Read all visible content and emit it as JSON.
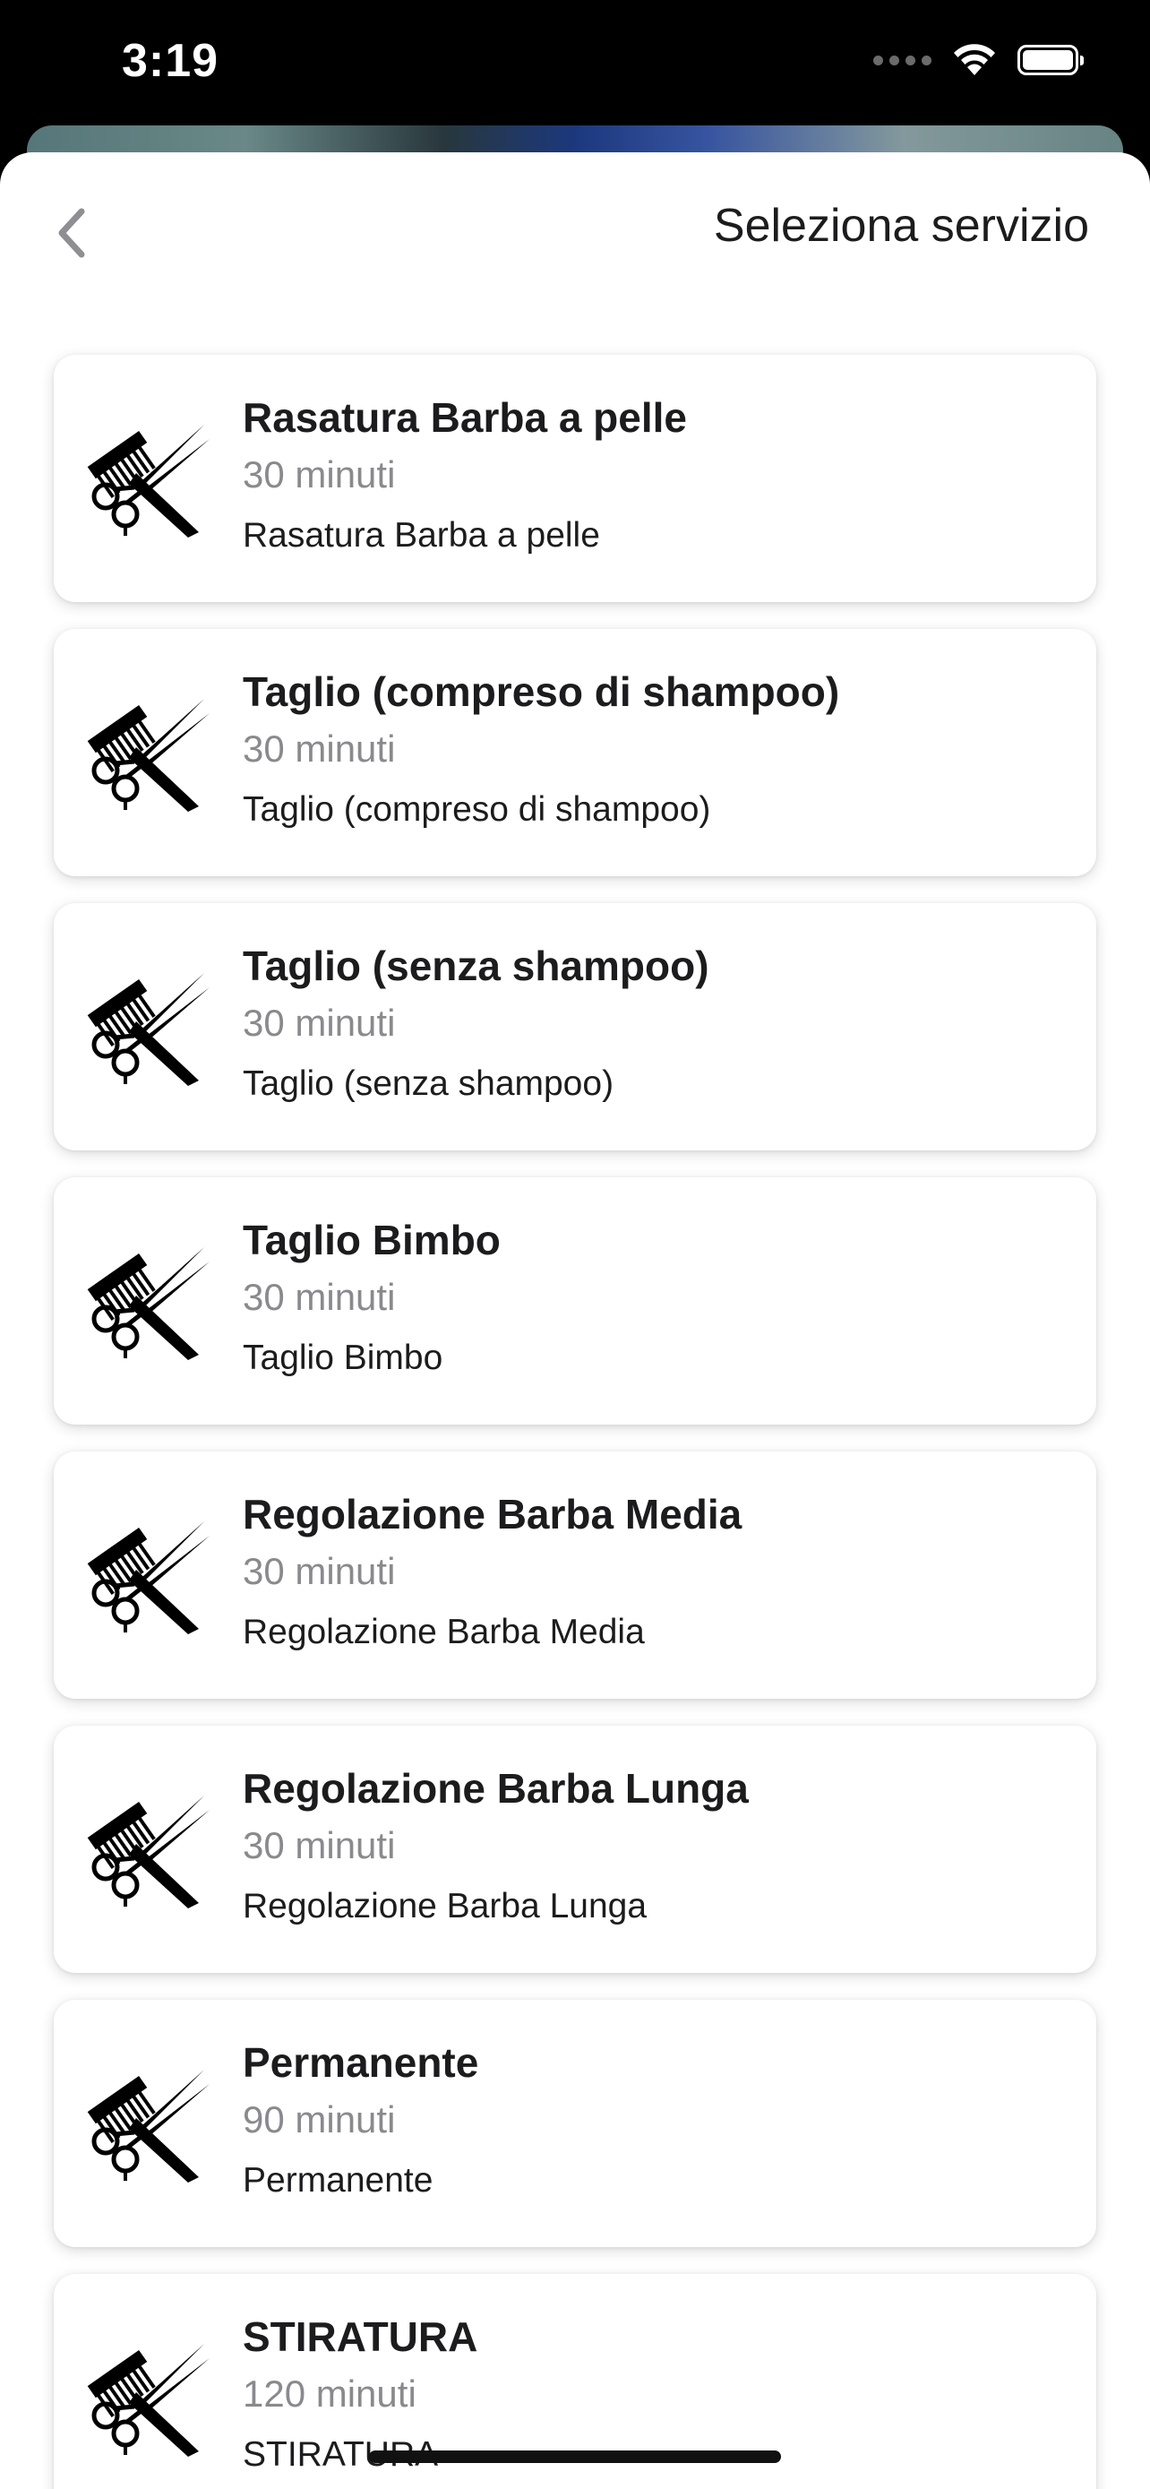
{
  "status_bar": {
    "time": "3:19",
    "icons": [
      "cellular-signal-icon",
      "wifi-icon",
      "battery-icon"
    ]
  },
  "header": {
    "back_icon": "chevron-left-icon",
    "title": "Seleziona servizio"
  },
  "services": [
    {
      "title": "Rasatura Barba a pelle",
      "duration": "30 minuti",
      "description": "Rasatura Barba a pelle",
      "icon": "barber-scissors-comb-icon"
    },
    {
      "title": "Taglio (compreso di shampoo)",
      "duration": "30 minuti",
      "description": "Taglio (compreso di shampoo)",
      "icon": "barber-scissors-comb-icon"
    },
    {
      "title": "Taglio (senza shampoo)",
      "duration": "30 minuti",
      "description": "Taglio (senza shampoo)",
      "icon": "barber-scissors-comb-icon"
    },
    {
      "title": "Taglio Bimbo",
      "duration": "30 minuti",
      "description": "Taglio Bimbo",
      "icon": "barber-scissors-comb-icon"
    },
    {
      "title": "Regolazione Barba Media",
      "duration": "30 minuti",
      "description": "Regolazione Barba Media",
      "icon": "barber-scissors-comb-icon"
    },
    {
      "title": "Regolazione Barba Lunga",
      "duration": "30 minuti",
      "description": "Regolazione Barba Lunga",
      "icon": "barber-scissors-comb-icon"
    },
    {
      "title": "Permanente",
      "duration": "90 minuti",
      "description": "Permanente",
      "icon": "barber-scissors-comb-icon"
    },
    {
      "title": "STIRATURA",
      "duration": "120 minuti",
      "description": "STIRATURA",
      "icon": "barber-scissors-comb-icon"
    }
  ],
  "colors": {
    "title_text": "#1c1c1e",
    "secondary_text": "#8a8a8e",
    "back_chevron": "#8e8e93",
    "card_background": "#ffffff"
  }
}
